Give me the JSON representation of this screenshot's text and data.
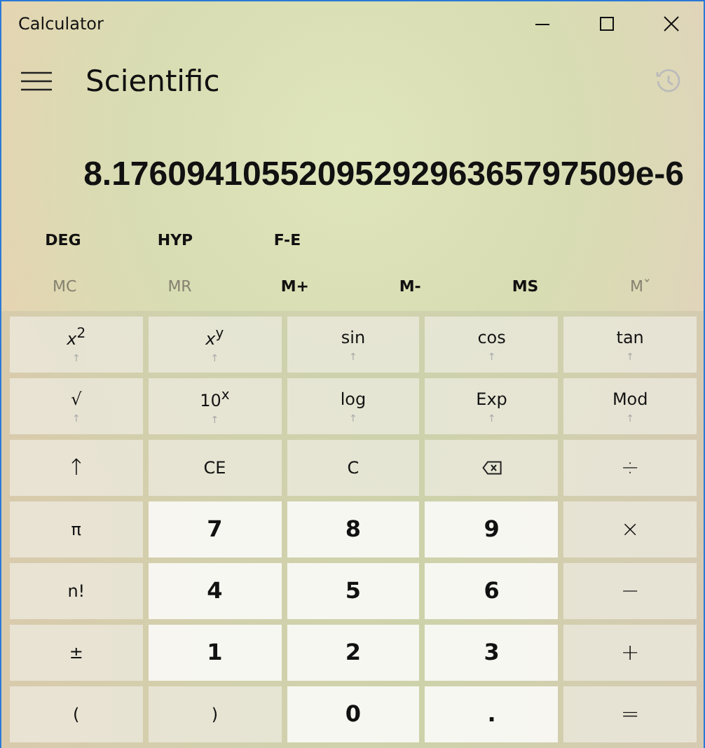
{
  "window": {
    "title": "Calculator"
  },
  "header": {
    "mode": "Scientific"
  },
  "display": {
    "value": "8.1760941055209529296365797509e-6"
  },
  "mode_buttons": [
    "DEG",
    "HYP",
    "F-E"
  ],
  "memory_buttons": [
    {
      "label": "MC",
      "disabled": true
    },
    {
      "label": "MR",
      "disabled": true
    },
    {
      "label": "M+",
      "disabled": false
    },
    {
      "label": "M-",
      "disabled": false
    },
    {
      "label": "MS",
      "disabled": false
    },
    {
      "label": "Mˇ",
      "disabled": true
    }
  ],
  "keys": [
    {
      "kind": "func",
      "label": "*x*$^{2}$",
      "sub": "↑"
    },
    {
      "kind": "func",
      "label": "*x*$^{y}$",
      "sub": "↑"
    },
    {
      "kind": "func",
      "label": "sin",
      "sub": "↑"
    },
    {
      "kind": "func",
      "label": "cos",
      "sub": "↑"
    },
    {
      "kind": "func",
      "label": "tan",
      "sub": "↑"
    },
    {
      "kind": "func",
      "label": "√",
      "sub": "↑"
    },
    {
      "kind": "func",
      "label": "10$^{x}$",
      "sub": "↑"
    },
    {
      "kind": "func",
      "label": "log",
      "sub": "↑"
    },
    {
      "kind": "func",
      "label": "Exp",
      "sub": "↑"
    },
    {
      "kind": "func",
      "label": "Mod",
      "sub": "↑"
    },
    {
      "kind": "big",
      "label": "↑"
    },
    {
      "kind": "func",
      "label": "CE"
    },
    {
      "kind": "func",
      "label": "C"
    },
    {
      "kind": "backspace"
    },
    {
      "kind": "big",
      "label": "÷"
    },
    {
      "kind": "func",
      "label": "π"
    },
    {
      "kind": "digit",
      "label": "7"
    },
    {
      "kind": "digit",
      "label": "8"
    },
    {
      "kind": "digit",
      "label": "9"
    },
    {
      "kind": "big",
      "label": "×"
    },
    {
      "kind": "func",
      "label": "n!"
    },
    {
      "kind": "digit",
      "label": "4"
    },
    {
      "kind": "digit",
      "label": "5"
    },
    {
      "kind": "digit",
      "label": "6"
    },
    {
      "kind": "big",
      "label": "−"
    },
    {
      "kind": "func",
      "label": "±"
    },
    {
      "kind": "digit",
      "label": "1"
    },
    {
      "kind": "digit",
      "label": "2"
    },
    {
      "kind": "digit",
      "label": "3"
    },
    {
      "kind": "big",
      "label": "+"
    },
    {
      "kind": "func",
      "label": "("
    },
    {
      "kind": "func",
      "label": ")"
    },
    {
      "kind": "digit",
      "label": "0"
    },
    {
      "kind": "digit",
      "label": "."
    },
    {
      "kind": "big",
      "label": "="
    }
  ]
}
